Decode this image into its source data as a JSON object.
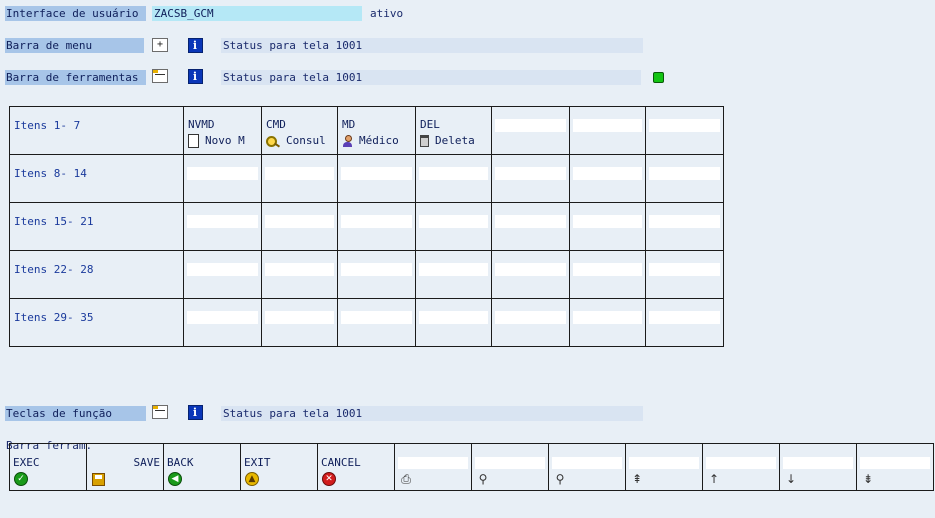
{
  "header": {
    "interface_label": "Interface de usuário",
    "interface_value": "ZACSB_GCM",
    "interface_status": "ativo",
    "menu_label": "Barra de menu",
    "menu_status": "Status para tela 1001",
    "toolbar_label": "Barra de ferramentas",
    "toolbar_status": "Status para tela 1001",
    "function_keys_label": "Teclas de função",
    "function_keys_status": "Status para tela 1001"
  },
  "grid": {
    "rows": [
      {
        "label": "Itens  1-  7"
      },
      {
        "label": "Itens  8- 14"
      },
      {
        "label": "Itens 15- 21"
      },
      {
        "label": "Itens 22- 28"
      },
      {
        "label": "Itens 29- 35"
      }
    ],
    "first_row_functions": [
      {
        "code": "NVMD",
        "text": "Novo M",
        "icon": "document-icon"
      },
      {
        "code": "CMD",
        "text": "Consul",
        "icon": "search-icon"
      },
      {
        "code": "MD",
        "text": "Médico",
        "icon": "person-icon"
      },
      {
        "code": "DEL",
        "text": "Deleta",
        "icon": "trash-icon"
      }
    ]
  },
  "application_toolbar": {
    "label": "Barra ferram.",
    "buttons": [
      {
        "code": "EXEC",
        "icon": "check-icon"
      },
      {
        "code": "SAVE",
        "icon": "save-icon"
      },
      {
        "code": "BACK",
        "icon": "back-icon"
      },
      {
        "code": "EXIT",
        "icon": "exit-icon"
      },
      {
        "code": "CANCEL",
        "icon": "cancel-icon"
      },
      {
        "code": "",
        "icon": "print-icon"
      },
      {
        "code": "",
        "icon": "find-icon"
      },
      {
        "code": "",
        "icon": "find-next-icon"
      },
      {
        "code": "",
        "icon": "first-page-icon"
      },
      {
        "code": "",
        "icon": "previous-page-icon"
      },
      {
        "code": "",
        "icon": "next-page-icon"
      },
      {
        "code": "",
        "icon": "last-page-icon"
      }
    ]
  },
  "colors": {
    "background": "#e8eff6",
    "label_bg": "#a7c5e8",
    "value_bg": "#b5e8f6",
    "status_bg": "#d9e4f2",
    "status_led": "#13c413"
  }
}
